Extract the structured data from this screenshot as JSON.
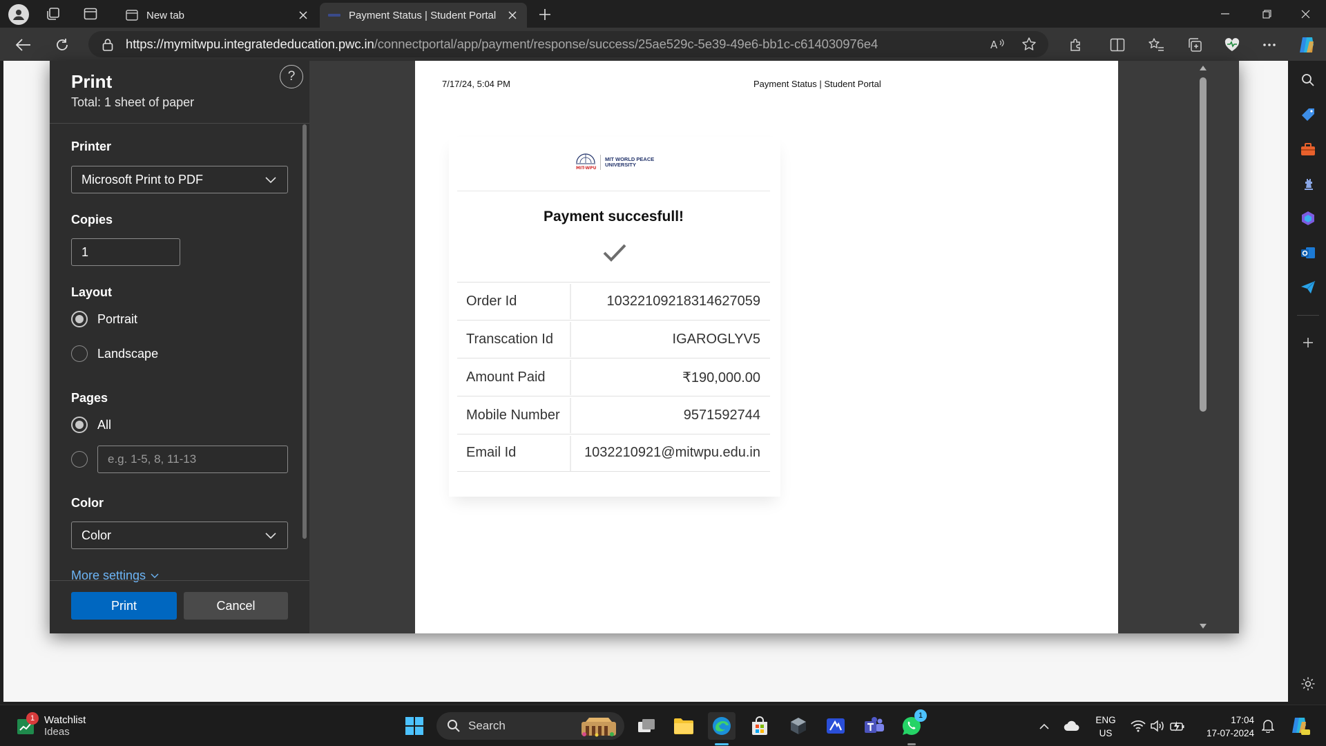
{
  "browser": {
    "tabs": [
      {
        "label": "New tab"
      },
      {
        "label": "Payment Status | Student Portal"
      }
    ],
    "url_host": "https://mymitwpu.integratededucation.pwc.in",
    "url_path": "/connectportal/app/payment/response/success/25ae529c-5e39-49e6-bb1c-c614030976e4"
  },
  "print_dialog": {
    "title": "Print",
    "subtitle": "Total: 1 sheet of paper",
    "help": "?",
    "printer": {
      "label": "Printer",
      "value": "Microsoft Print to PDF"
    },
    "copies": {
      "label": "Copies",
      "value": "1"
    },
    "layout": {
      "label": "Layout",
      "options": [
        "Portrait",
        "Landscape"
      ],
      "selected": "Portrait"
    },
    "pages": {
      "label": "Pages",
      "option_all": "All",
      "custom_placeholder": "e.g. 1-5, 8, 11-13",
      "selected": "All"
    },
    "color": {
      "label": "Color",
      "value": "Color"
    },
    "more_settings": "More settings",
    "print_button": "Print",
    "cancel_button": "Cancel"
  },
  "preview": {
    "header_date": "7/17/24, 5:04 PM",
    "header_title": "Payment Status | Student Portal",
    "logo_text_1": "MIT WORLD PEACE",
    "logo_text_2": "UNIVERSITY",
    "heading": "Payment succesfull!",
    "rows": [
      {
        "key": "Order Id",
        "value": "10322109218314627059"
      },
      {
        "key": "Transcation Id",
        "value": "IGAROGLYV5"
      },
      {
        "key": "Amount Paid",
        "value": "₹190,000.00"
      },
      {
        "key": "Mobile Number",
        "value": "9571592744"
      },
      {
        "key": "Email Id",
        "value": "1032210921@mitwpu.edu.in"
      }
    ]
  },
  "taskbar": {
    "widget_title": "Watchlist",
    "widget_sub": "Ideas",
    "widget_badge": "1",
    "search_label": "Search",
    "whatsapp_badge": "1",
    "lang_line1": "ENG",
    "lang_line2": "US",
    "time": "17:04",
    "date": "17-07-2024"
  },
  "colors": {
    "accent": "#0067c0",
    "link": "#6cb4f5",
    "chrome_bg": "#202020",
    "panel_bg": "#2d2d2d"
  }
}
